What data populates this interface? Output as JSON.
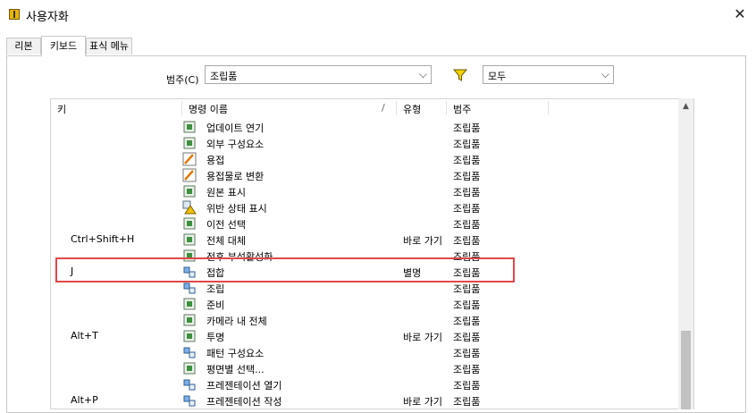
{
  "window": {
    "title": "사용자화",
    "close_glyph": "✕"
  },
  "tabs": [
    {
      "label": "리본",
      "active": false
    },
    {
      "label": "키보드",
      "active": true
    },
    {
      "label": "표식 메뉴",
      "active": false
    }
  ],
  "filters": {
    "category_label": "범주(C)",
    "category_value": "조립품",
    "filter_value": "모두",
    "chevron": "⌵"
  },
  "columns": {
    "key": "키",
    "command": "명령 이름",
    "sort_mark": "/",
    "type": "유형",
    "category": "범주"
  },
  "scroll": {
    "up_glyph": "▲"
  },
  "rows": [
    {
      "key": "",
      "name": "업데이트 연기",
      "type": "",
      "category": "조립품",
      "icon": "defer-update-icon"
    },
    {
      "key": "",
      "name": "외부 구성요소",
      "type": "",
      "category": "조립품",
      "icon": "external-component-icon"
    },
    {
      "key": "",
      "name": "용접",
      "type": "",
      "category": "조립품",
      "icon": "weld-icon"
    },
    {
      "key": "",
      "name": "용접물로 변환",
      "type": "",
      "category": "조립품",
      "icon": "convert-weldment-icon"
    },
    {
      "key": "",
      "name": "원본 표시",
      "type": "",
      "category": "조립품",
      "icon": "show-original-icon"
    },
    {
      "key": "",
      "name": "위반 상태 표시",
      "type": "",
      "category": "조립품",
      "icon": "violation-warning-icon"
    },
    {
      "key": "",
      "name": "이전 선택",
      "type": "",
      "category": "조립품",
      "icon": "previous-selection-icon"
    },
    {
      "key": "Ctrl+Shift+H",
      "name": "전체 대체",
      "type": "바로 가기",
      "category": "조립품",
      "icon": "replace-all-icon"
    },
    {
      "key": "",
      "name": "전후 부석활성화",
      "type": "",
      "category": "조립품",
      "icon": "analysis-icon"
    },
    {
      "key": "J",
      "name": "접합",
      "type": "별명",
      "category": "조립품",
      "icon": "joint-icon",
      "highlight": true
    },
    {
      "key": "",
      "name": "조립",
      "type": "",
      "category": "조립품",
      "icon": "assemble-icon"
    },
    {
      "key": "",
      "name": "준비",
      "type": "",
      "category": "조립품",
      "icon": "prepare-icon"
    },
    {
      "key": "",
      "name": "카메라 내 전체",
      "type": "",
      "category": "조립품",
      "icon": "camera-fit-icon"
    },
    {
      "key": "Alt+T",
      "name": "투명",
      "type": "바로 가기",
      "category": "조립품",
      "icon": "transparent-icon"
    },
    {
      "key": "",
      "name": "패턴 구성요소",
      "type": "",
      "category": "조립품",
      "icon": "pattern-component-icon"
    },
    {
      "key": "",
      "name": "평면별 선택...",
      "type": "",
      "category": "조립품",
      "icon": "select-by-plane-icon"
    },
    {
      "key": "",
      "name": "프레젠테이션 열기",
      "type": "",
      "category": "조립품",
      "icon": "open-presentation-icon"
    },
    {
      "key": "Alt+P",
      "name": "프레젠테이션 작성",
      "type": "바로 가기",
      "category": "조립품",
      "icon": "create-presentation-icon"
    }
  ]
}
